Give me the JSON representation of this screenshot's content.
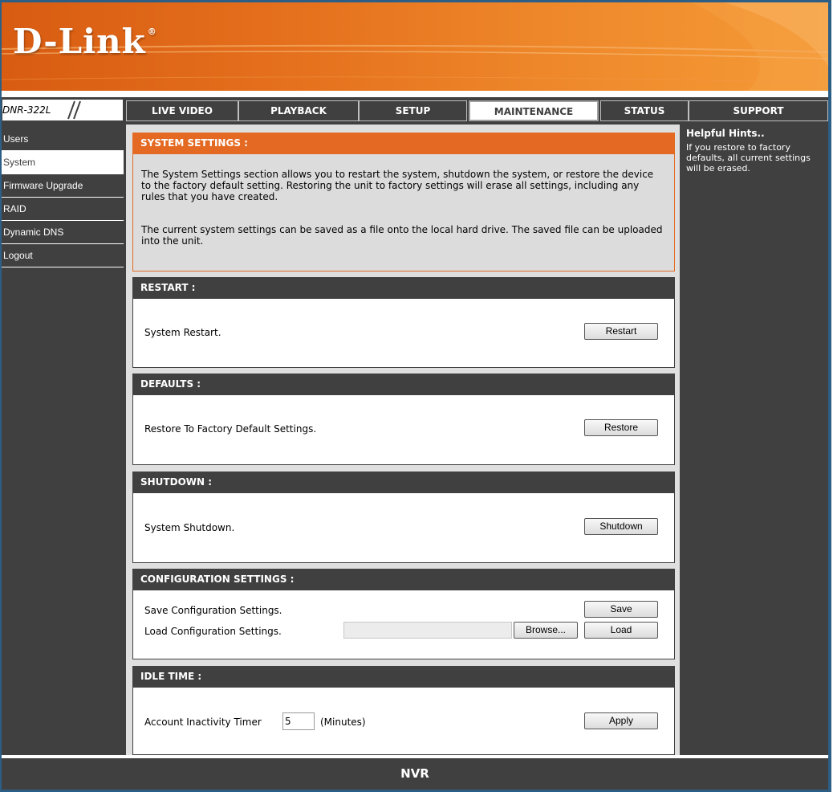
{
  "header": {
    "logo": "D-Link",
    "logo_mark": "®"
  },
  "model": "DNR-322L",
  "tabs": [
    {
      "label": "LIVE VIDEO",
      "active": false
    },
    {
      "label": "PLAYBACK",
      "active": false
    },
    {
      "label": "SETUP",
      "active": false
    },
    {
      "label": "MAINTENANCE",
      "active": true
    },
    {
      "label": "STATUS",
      "active": false
    },
    {
      "label": "SUPPORT",
      "active": false
    }
  ],
  "sidebar": {
    "items": [
      {
        "label": "Users",
        "active": false
      },
      {
        "label": "System",
        "active": true
      },
      {
        "label": "Firmware Upgrade",
        "active": false
      },
      {
        "label": "RAID",
        "active": false
      },
      {
        "label": "Dynamic DNS",
        "active": false
      },
      {
        "label": "Logout",
        "active": false
      }
    ]
  },
  "system_settings": {
    "title": "SYSTEM SETTINGS :",
    "paragraph1": "The System Settings section allows you to restart the system, shutdown the system, or restore the device to the factory default setting. Restoring the unit to factory settings will erase all settings, including any rules that you have created.",
    "paragraph2": "The current system settings can be saved as a file onto the local hard drive. The saved file can be uploaded into the unit."
  },
  "restart": {
    "title": "RESTART :",
    "text": "System Restart.",
    "button": "Restart"
  },
  "defaults": {
    "title": "DEFAULTS :",
    "text": "Restore To Factory Default Settings.",
    "button": "Restore"
  },
  "shutdown": {
    "title": "SHUTDOWN :",
    "text": "System Shutdown.",
    "button": "Shutdown"
  },
  "config": {
    "title": "CONFIGURATION SETTINGS :",
    "save_text": "Save Configuration Settings.",
    "save_button": "Save",
    "load_text": "Load Configuration Settings.",
    "file_value": "",
    "browse_button": "Browse...",
    "load_button": "Load"
  },
  "idle": {
    "title": "IDLE TIME :",
    "label": "Account Inactivity Timer",
    "value": "5",
    "unit": "(Minutes)",
    "button": "Apply"
  },
  "hints": {
    "title": "Helpful Hints..",
    "text": "If you restore to factory defaults, all current settings will be erased."
  },
  "footer": {
    "label": "NVR"
  },
  "colors": {
    "accent_orange": "#e46a23",
    "nav_dark": "#404040",
    "frame_blue": "#2d5f86",
    "content_bg": "#dfdfdf"
  }
}
